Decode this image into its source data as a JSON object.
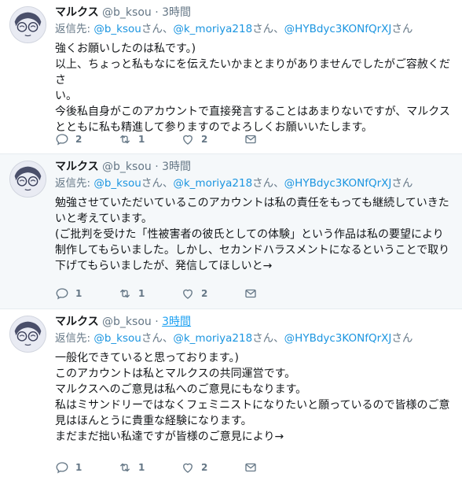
{
  "tweets": [
    {
      "name": "マルクス",
      "handle": "@b_ksou",
      "dot": "·",
      "time": "3時間",
      "reply_label": "返信先:",
      "mentions": [
        "@b_ksou",
        "@k_moriya218",
        "@HYBdyc3KONfQrXJ"
      ],
      "san": "さん",
      "sep": "、",
      "lines": [
        "強くお願いしたのは私です。)",
        "以上、ちょっと私もなにを伝えたいかまとまりがありませんでしたがご容赦くださ",
        "い。",
        "今後私自身がこのアカウントで直接発言することはあまりないですが、マルクス",
        "とともに私も精進して参りますのでよろしくお願いいたします。"
      ],
      "reply_count": "2",
      "retweet_count": "1",
      "like_count": "2"
    },
    {
      "name": "マルクス",
      "handle": "@b_ksou",
      "dot": "·",
      "time": "3時間",
      "reply_label": "返信先:",
      "mentions": [
        "@b_ksou",
        "@k_moriya218",
        "@HYBdyc3KONfQrXJ"
      ],
      "san": "さん",
      "sep": "、",
      "lines": [
        "勉強させていただいているこのアカウントは私の責任をもっても継続していきた",
        "いと考えています。",
        "(ご批判を受けた「性被害者の彼氏としての体験」という作品は私の要望により",
        "制作してもらいました。しかし、セカンドハラスメントになるということで取り",
        "下げてもらいましたが、発信してほしいと→"
      ],
      "reply_count": "1",
      "retweet_count": "1",
      "like_count": "2"
    },
    {
      "name": "マルクス",
      "handle": "@b_ksou",
      "dot": "·",
      "time": "3時間",
      "reply_label": "返信先:",
      "mentions": [
        "@b_ksou",
        "@k_moriya218",
        "@HYBdyc3KONfQrXJ"
      ],
      "san": "さん",
      "sep": "、",
      "lines": [
        "一般化できていると思っております。)",
        "このアカウントは私とマルクスの共同運営です。",
        "マルクスへのご意見は私へのご意見にもなります。",
        "私はミサンドリーではなくフェミニストになりたいと願っているので皆様のご意",
        "見はほんとうに貴重な経験になります。",
        "まだまだ拙い私達ですが皆様のご意見により→"
      ],
      "reply_count": "1",
      "retweet_count": "1",
      "like_count": "2"
    }
  ],
  "icons": {
    "reply": "reply-icon",
    "retweet": "retweet-icon",
    "like": "heart-icon",
    "dm": "envelope-icon"
  },
  "colors": {
    "link": "#1b95e0",
    "muted": "#657786",
    "highlight_bg": "#f5f8fa"
  }
}
